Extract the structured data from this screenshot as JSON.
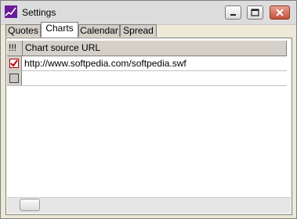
{
  "window": {
    "title": "Settings",
    "app_icon": "chart-line-icon"
  },
  "tabs": [
    {
      "label": "Quotes"
    },
    {
      "label": "Charts",
      "active": true
    },
    {
      "label": "Calendar"
    },
    {
      "label": "Spread"
    }
  ],
  "grid": {
    "columns": [
      "!!!",
      "Chart source URL"
    ],
    "rows": [
      {
        "checked": true,
        "url": "http://www.softpedia.com/softpedia.swf"
      },
      {
        "checked": false,
        "url": ""
      }
    ]
  }
}
